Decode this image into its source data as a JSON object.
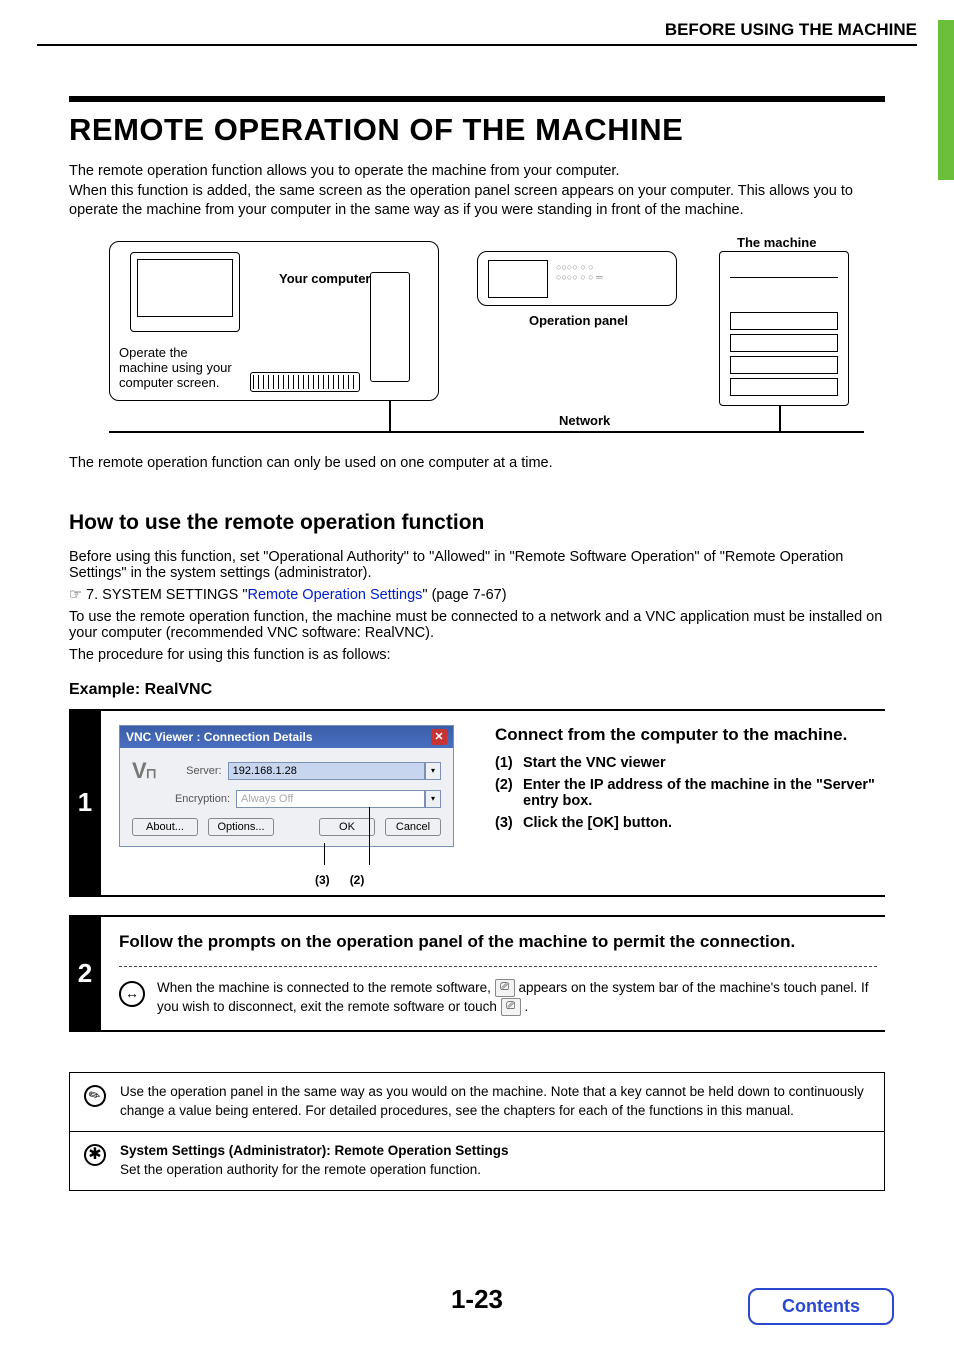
{
  "header": {
    "section": "BEFORE USING THE MACHINE"
  },
  "title": "REMOTE OPERATION OF THE MACHINE",
  "intro": "The remote operation function allows you to operate the machine from your computer.\nWhen this function is added, the same screen as the operation panel screen appears on your computer. This allows you to operate the machine from your computer in the same way as if you were standing in front of the machine.",
  "diagram": {
    "your_computer": "Your computer",
    "operate_note": "Operate the machine using your computer screen.",
    "operation_panel": "Operation panel",
    "the_machine": "The machine",
    "network": "Network"
  },
  "after_diagram": "The remote operation function can only be used on one computer at a time.",
  "howto": {
    "heading": "How to use the remote operation function",
    "p1": "Before using this function, set \"Operational Authority\" to \"Allowed\" in \"Remote Software Operation\" of \"Remote Operation Settings\" in the system settings (administrator).",
    "xref_prefix": "☞ 7. SYSTEM SETTINGS \"",
    "xref_link": "Remote Operation Settings",
    "xref_suffix": "\" (page 7-67)",
    "p2": "To use the remote operation function, the machine must be connected to a network and a VNC application must be installed on your computer (recommended VNC software: RealVNC).",
    "p3": "The procedure for using this function is as follows:",
    "example_h": "Example: RealVNC"
  },
  "vnc": {
    "title": "VNC Viewer : Connection Details",
    "server_label": "Server:",
    "server_value": "192.168.1.28",
    "encryption_label": "Encryption:",
    "encryption_value": "Always Off",
    "about": "About...",
    "options": "Options...",
    "ok": "OK",
    "cancel": "Cancel",
    "ptr3": "(3)",
    "ptr2": "(2)"
  },
  "step1": {
    "num": "1",
    "heading": "Connect from the computer to the machine.",
    "i1_n": "(1)",
    "i1_t": "Start the VNC viewer",
    "i2_n": "(2)",
    "i2_t": "Enter the IP address of the machine in the \"Server\" entry box.",
    "i3_n": "(3)",
    "i3_t": "Click the [OK] button."
  },
  "step2": {
    "num": "2",
    "heading": "Follow the prompts on the operation panel of the machine to permit the connection.",
    "note_a": "When the machine is connected to the remote software, ",
    "note_b": " appears on the system bar of the machine's touch panel. If you wish to disconnect, exit the remote software or touch ",
    "note_c": " ."
  },
  "box1": "Use the operation panel in the same way as you would on the machine. Note that a key cannot be held down to continuously change a value being entered. For detailed procedures, see the chapters for each of the functions in this manual.",
  "box2": {
    "title": "System Settings (Administrator): Remote Operation Settings",
    "body": "Set the operation authority for the remote operation function."
  },
  "page": "1-23",
  "contents": "Contents"
}
